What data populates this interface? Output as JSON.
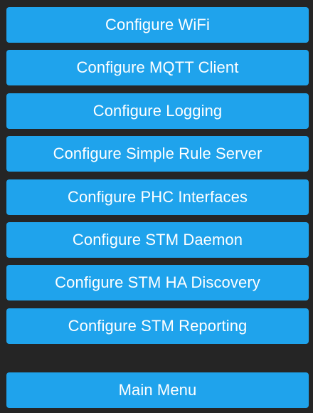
{
  "menu": {
    "items": [
      {
        "label": "Configure WiFi"
      },
      {
        "label": "Configure MQTT Client"
      },
      {
        "label": "Configure Logging"
      },
      {
        "label": "Configure Simple Rule Server"
      },
      {
        "label": "Configure PHC Interfaces"
      },
      {
        "label": "Configure STM Daemon"
      },
      {
        "label": "Configure STM HA Discovery"
      },
      {
        "label": "Configure STM Reporting"
      }
    ],
    "main_menu_label": "Main Menu"
  },
  "colors": {
    "background": "#252525",
    "button": "#1fa3ec",
    "button_text": "#ffffff"
  }
}
